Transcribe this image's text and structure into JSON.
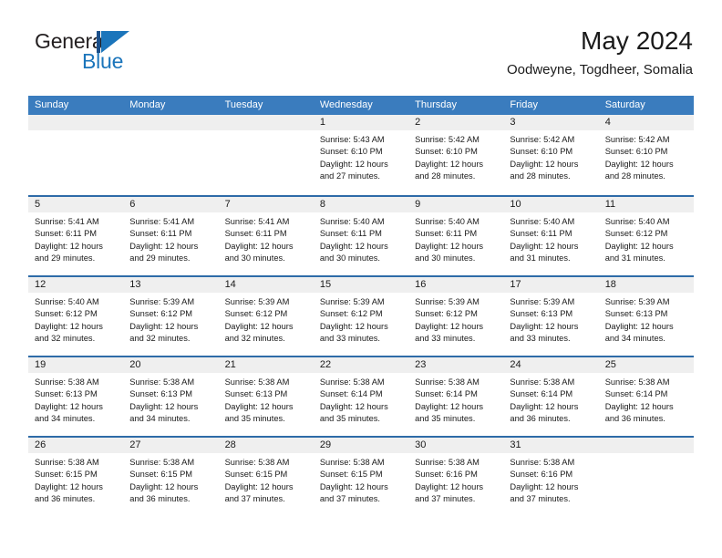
{
  "brand": {
    "name_primary": "General",
    "name_secondary": "Blue",
    "logo_icon": "general-blue-triangle-logo"
  },
  "header": {
    "title": "May 2024",
    "subtitle": "Oodweyne, Togdheer, Somalia"
  },
  "colors": {
    "header_blue": "#3a7cbe",
    "rule_blue": "#2e6ba8",
    "brand_blue": "#1b75bb",
    "day_band_gray": "#efefef",
    "text": "#1a1a1a"
  },
  "weekdays": [
    "Sunday",
    "Monday",
    "Tuesday",
    "Wednesday",
    "Thursday",
    "Friday",
    "Saturday"
  ],
  "weeks": [
    [
      {
        "day": "",
        "sunrise": "",
        "sunset": "",
        "daylight_line1": "",
        "daylight_line2": ""
      },
      {
        "day": "",
        "sunrise": "",
        "sunset": "",
        "daylight_line1": "",
        "daylight_line2": ""
      },
      {
        "day": "",
        "sunrise": "",
        "sunset": "",
        "daylight_line1": "",
        "daylight_line2": ""
      },
      {
        "day": "1",
        "sunrise": "Sunrise: 5:43 AM",
        "sunset": "Sunset: 6:10 PM",
        "daylight_line1": "Daylight: 12 hours",
        "daylight_line2": "and 27 minutes."
      },
      {
        "day": "2",
        "sunrise": "Sunrise: 5:42 AM",
        "sunset": "Sunset: 6:10 PM",
        "daylight_line1": "Daylight: 12 hours",
        "daylight_line2": "and 28 minutes."
      },
      {
        "day": "3",
        "sunrise": "Sunrise: 5:42 AM",
        "sunset": "Sunset: 6:10 PM",
        "daylight_line1": "Daylight: 12 hours",
        "daylight_line2": "and 28 minutes."
      },
      {
        "day": "4",
        "sunrise": "Sunrise: 5:42 AM",
        "sunset": "Sunset: 6:10 PM",
        "daylight_line1": "Daylight: 12 hours",
        "daylight_line2": "and 28 minutes."
      }
    ],
    [
      {
        "day": "5",
        "sunrise": "Sunrise: 5:41 AM",
        "sunset": "Sunset: 6:11 PM",
        "daylight_line1": "Daylight: 12 hours",
        "daylight_line2": "and 29 minutes."
      },
      {
        "day": "6",
        "sunrise": "Sunrise: 5:41 AM",
        "sunset": "Sunset: 6:11 PM",
        "daylight_line1": "Daylight: 12 hours",
        "daylight_line2": "and 29 minutes."
      },
      {
        "day": "7",
        "sunrise": "Sunrise: 5:41 AM",
        "sunset": "Sunset: 6:11 PM",
        "daylight_line1": "Daylight: 12 hours",
        "daylight_line2": "and 30 minutes."
      },
      {
        "day": "8",
        "sunrise": "Sunrise: 5:40 AM",
        "sunset": "Sunset: 6:11 PM",
        "daylight_line1": "Daylight: 12 hours",
        "daylight_line2": "and 30 minutes."
      },
      {
        "day": "9",
        "sunrise": "Sunrise: 5:40 AM",
        "sunset": "Sunset: 6:11 PM",
        "daylight_line1": "Daylight: 12 hours",
        "daylight_line2": "and 30 minutes."
      },
      {
        "day": "10",
        "sunrise": "Sunrise: 5:40 AM",
        "sunset": "Sunset: 6:11 PM",
        "daylight_line1": "Daylight: 12 hours",
        "daylight_line2": "and 31 minutes."
      },
      {
        "day": "11",
        "sunrise": "Sunrise: 5:40 AM",
        "sunset": "Sunset: 6:12 PM",
        "daylight_line1": "Daylight: 12 hours",
        "daylight_line2": "and 31 minutes."
      }
    ],
    [
      {
        "day": "12",
        "sunrise": "Sunrise: 5:40 AM",
        "sunset": "Sunset: 6:12 PM",
        "daylight_line1": "Daylight: 12 hours",
        "daylight_line2": "and 32 minutes."
      },
      {
        "day": "13",
        "sunrise": "Sunrise: 5:39 AM",
        "sunset": "Sunset: 6:12 PM",
        "daylight_line1": "Daylight: 12 hours",
        "daylight_line2": "and 32 minutes."
      },
      {
        "day": "14",
        "sunrise": "Sunrise: 5:39 AM",
        "sunset": "Sunset: 6:12 PM",
        "daylight_line1": "Daylight: 12 hours",
        "daylight_line2": "and 32 minutes."
      },
      {
        "day": "15",
        "sunrise": "Sunrise: 5:39 AM",
        "sunset": "Sunset: 6:12 PM",
        "daylight_line1": "Daylight: 12 hours",
        "daylight_line2": "and 33 minutes."
      },
      {
        "day": "16",
        "sunrise": "Sunrise: 5:39 AM",
        "sunset": "Sunset: 6:12 PM",
        "daylight_line1": "Daylight: 12 hours",
        "daylight_line2": "and 33 minutes."
      },
      {
        "day": "17",
        "sunrise": "Sunrise: 5:39 AM",
        "sunset": "Sunset: 6:13 PM",
        "daylight_line1": "Daylight: 12 hours",
        "daylight_line2": "and 33 minutes."
      },
      {
        "day": "18",
        "sunrise": "Sunrise: 5:39 AM",
        "sunset": "Sunset: 6:13 PM",
        "daylight_line1": "Daylight: 12 hours",
        "daylight_line2": "and 34 minutes."
      }
    ],
    [
      {
        "day": "19",
        "sunrise": "Sunrise: 5:38 AM",
        "sunset": "Sunset: 6:13 PM",
        "daylight_line1": "Daylight: 12 hours",
        "daylight_line2": "and 34 minutes."
      },
      {
        "day": "20",
        "sunrise": "Sunrise: 5:38 AM",
        "sunset": "Sunset: 6:13 PM",
        "daylight_line1": "Daylight: 12 hours",
        "daylight_line2": "and 34 minutes."
      },
      {
        "day": "21",
        "sunrise": "Sunrise: 5:38 AM",
        "sunset": "Sunset: 6:13 PM",
        "daylight_line1": "Daylight: 12 hours",
        "daylight_line2": "and 35 minutes."
      },
      {
        "day": "22",
        "sunrise": "Sunrise: 5:38 AM",
        "sunset": "Sunset: 6:14 PM",
        "daylight_line1": "Daylight: 12 hours",
        "daylight_line2": "and 35 minutes."
      },
      {
        "day": "23",
        "sunrise": "Sunrise: 5:38 AM",
        "sunset": "Sunset: 6:14 PM",
        "daylight_line1": "Daylight: 12 hours",
        "daylight_line2": "and 35 minutes."
      },
      {
        "day": "24",
        "sunrise": "Sunrise: 5:38 AM",
        "sunset": "Sunset: 6:14 PM",
        "daylight_line1": "Daylight: 12 hours",
        "daylight_line2": "and 36 minutes."
      },
      {
        "day": "25",
        "sunrise": "Sunrise: 5:38 AM",
        "sunset": "Sunset: 6:14 PM",
        "daylight_line1": "Daylight: 12 hours",
        "daylight_line2": "and 36 minutes."
      }
    ],
    [
      {
        "day": "26",
        "sunrise": "Sunrise: 5:38 AM",
        "sunset": "Sunset: 6:15 PM",
        "daylight_line1": "Daylight: 12 hours",
        "daylight_line2": "and 36 minutes."
      },
      {
        "day": "27",
        "sunrise": "Sunrise: 5:38 AM",
        "sunset": "Sunset: 6:15 PM",
        "daylight_line1": "Daylight: 12 hours",
        "daylight_line2": "and 36 minutes."
      },
      {
        "day": "28",
        "sunrise": "Sunrise: 5:38 AM",
        "sunset": "Sunset: 6:15 PM",
        "daylight_line1": "Daylight: 12 hours",
        "daylight_line2": "and 37 minutes."
      },
      {
        "day": "29",
        "sunrise": "Sunrise: 5:38 AM",
        "sunset": "Sunset: 6:15 PM",
        "daylight_line1": "Daylight: 12 hours",
        "daylight_line2": "and 37 minutes."
      },
      {
        "day": "30",
        "sunrise": "Sunrise: 5:38 AM",
        "sunset": "Sunset: 6:16 PM",
        "daylight_line1": "Daylight: 12 hours",
        "daylight_line2": "and 37 minutes."
      },
      {
        "day": "31",
        "sunrise": "Sunrise: 5:38 AM",
        "sunset": "Sunset: 6:16 PM",
        "daylight_line1": "Daylight: 12 hours",
        "daylight_line2": "and 37 minutes."
      },
      {
        "day": "",
        "sunrise": "",
        "sunset": "",
        "daylight_line1": "",
        "daylight_line2": ""
      }
    ]
  ]
}
